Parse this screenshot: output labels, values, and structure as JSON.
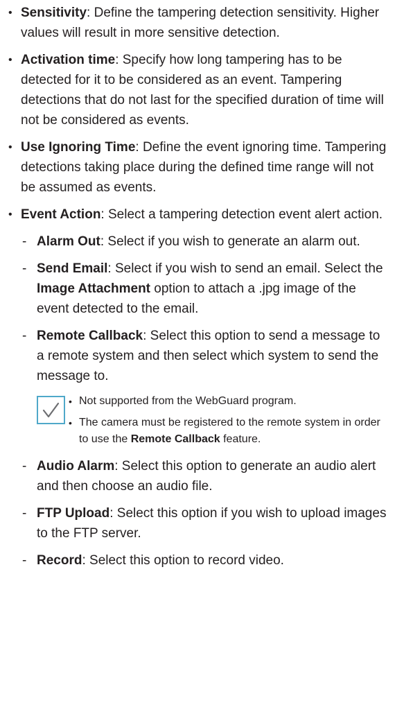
{
  "items": [
    {
      "term": "Sensitivity",
      "text": ": Define the tampering detection sensitivity. Higher values will result in more sensitive detection."
    },
    {
      "term": "Activation time",
      "text": ": Specify how long tampering has to be detected for it to be considered as an event. Tampering detections that do not last for the specified duration of time will not be considered as events."
    },
    {
      "term": "Use Ignoring Time",
      "text": ": Define the event ignoring time. Tampering detections taking place during the defined time range will not be assumed as events."
    },
    {
      "term": "Event Action",
      "text": ": Select a tampering detection event alert action."
    }
  ],
  "subitems": [
    {
      "term": "Alarm Out",
      "text": ": Select if you wish to generate an alarm out."
    },
    {
      "term": "Send Email",
      "text": ": Select if you wish to send an email. Select the ",
      "term2": "Image Attachment",
      "text2": " option to attach a .jpg image of the event detected to the email."
    },
    {
      "term": "Remote Callback",
      "text": ": Select this option to send a message to a remote system and then select which system to send the message to."
    },
    {
      "term": "Audio Alarm",
      "text": ": Select this option to generate an audio alert and then choose an audio file."
    },
    {
      "term": "FTP Upload",
      "text": ": Select this option if you wish to upload images to the FTP server."
    },
    {
      "term": "Record",
      "text": ": Select this option to record video."
    }
  ],
  "note": {
    "icon": "checkmark-icon",
    "accent_color": "#4fa8c9",
    "lines": [
      {
        "text": "Not supported from the WebGuard program."
      },
      {
        "text": "The camera must be registered to the remote system in order to use the ",
        "term": "Remote Callback",
        "text2": " feature."
      }
    ]
  }
}
